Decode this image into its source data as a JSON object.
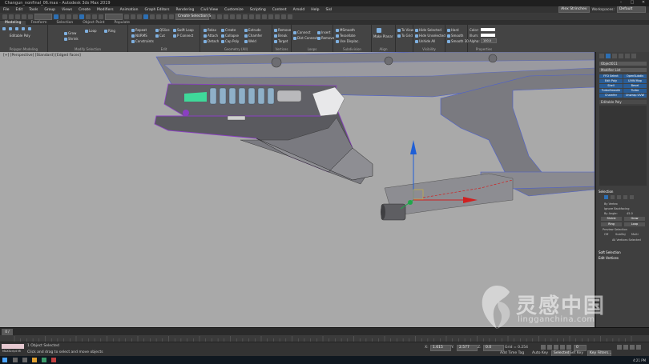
{
  "window": {
    "title": "Changun_nonfinal_06.max - Autodesk 3ds Max 2019"
  },
  "menu": {
    "items": [
      "File",
      "Edit",
      "Tools",
      "Group",
      "Views",
      "Create",
      "Modifiers",
      "Animation",
      "Graph Editors",
      "Rendering",
      "Civil View",
      "Customize",
      "Scripting",
      "Content",
      "Arnold",
      "Help",
      "Sisl"
    ],
    "user": "Alex Strinchev",
    "workspace_label": "Workspaces:",
    "workspace_value": "Default"
  },
  "toolbar": {
    "selection_set_placeholder": "Create Selection Se"
  },
  "ribbon": {
    "tabs": [
      "Modeling",
      "Freeform",
      "Selection",
      "Object Paint",
      "Populate"
    ],
    "groups": [
      {
        "label": "Polygon Modeling"
      },
      {
        "label": "Modify Selection"
      },
      {
        "label": "Edit"
      },
      {
        "label": "Geometry (All)"
      },
      {
        "label": "Vertices"
      },
      {
        "label": "Loops"
      },
      {
        "label": "Subdivision"
      },
      {
        "label": "Align"
      },
      {
        "label": "Visibility"
      },
      {
        "label": "Properties"
      }
    ],
    "buttons": {
      "editable_poly": "Editable Poly",
      "grow": "Grow",
      "shrink": "Shrink",
      "loop": "Loop",
      "ring": "Ring",
      "repeat": "Repeat",
      "quickslice": "QSlice",
      "swift_loop": "Swift Loop",
      "nurms": "NURMS",
      "cut": "Cut",
      "p_connect": "P Connect",
      "constraints": "Constraints",
      "relax": "Relax",
      "create": "Create",
      "extrude": "Extrude",
      "remove": "Remove",
      "attach": "Attach",
      "collapse": "Collapse",
      "chamfer": "Chamfer",
      "break": "Break",
      "detach": "Detach",
      "cap_poly": "Cap Poly",
      "weld": "Weld",
      "target": "Target",
      "connect": "Connect",
      "dist_connect": "Dist Connect",
      "insert": "Insert",
      "remove2": "Remove",
      "msmooth": "MSmooth",
      "tessellate": "Tessellate",
      "use_displace": "Use Displac.",
      "make_planar": "Make Planar",
      "to_view": "To View",
      "to_grid": "To Grid",
      "hide_selected": "Hide Selected",
      "hide_unselected": "Hide Unselected",
      "unhide_all": "Unhide All",
      "hard": "Hard",
      "smooth": "Smooth",
      "smooth30": "Smooth 30",
      "color": "Color:",
      "illum": "Illum:",
      "alpha": "Alpha:",
      "alpha_value": "100.0"
    }
  },
  "viewport": {
    "label": "[+] [Perspective] [Standard] [Edged Faces]"
  },
  "command_panel": {
    "object_name": "Object011",
    "modifier_list": "Modifier List",
    "buttons": [
      "FFD Select",
      "OpenSubdiv",
      "Edit Poly",
      "UVW Map",
      "Shell",
      "Bevel",
      "TurboSmooth",
      "Turbo",
      "Chamfer",
      "Unwrap UVW"
    ],
    "stack_item": "Editable Poly",
    "selection_header": "Selection",
    "by_vertex": "By Vertex",
    "ignore_backfacing": "Ignore Backfacing",
    "by_angle": "By Angle:",
    "by_angle_value": "45.0",
    "shrink": "Shrink",
    "grow": "Grow",
    "ring": "Ring",
    "loop": "Loop",
    "preview_selection": "Preview Selection",
    "off": "Off",
    "subobj": "SubObj",
    "multi": "Multi",
    "selected_info": "All Vertices Selected",
    "soft_selection": "Soft Selection",
    "edit_vertices": "Edit Vertices"
  },
  "timeline": {
    "frame_display": "0 / 100"
  },
  "status": {
    "selection": "1 Object Selected",
    "prompt": "Click and drag to select and move objects",
    "x_label": "X:",
    "x_value": "1.615",
    "y_label": "Y:",
    "y_value": "2.577",
    "z_label": "Z:",
    "z_value": "0.0",
    "grid": "Grid = 0.254",
    "add_time_tag": "Add Time Tag",
    "auto_key": "Auto Key",
    "selected": "Selected",
    "set_key": "Set Key",
    "key_filters": "Key Filters...",
    "frame": "0",
    "maxscript": "MAXScript Mi"
  },
  "taskbar": {
    "time": "4:21 PM"
  },
  "watermark": {
    "cn_text": "灵感中国",
    "url": "lingganchina.com"
  },
  "colors": {
    "viewport_bg": "#a9a9a9",
    "accent": "#2d6fb3",
    "selection_purple": "#8a3fc2",
    "axis_red": "#d02020",
    "axis_blue": "#1f5fd6",
    "axis_green": "#1fa84a",
    "highlight_green": "#3fd99a"
  }
}
